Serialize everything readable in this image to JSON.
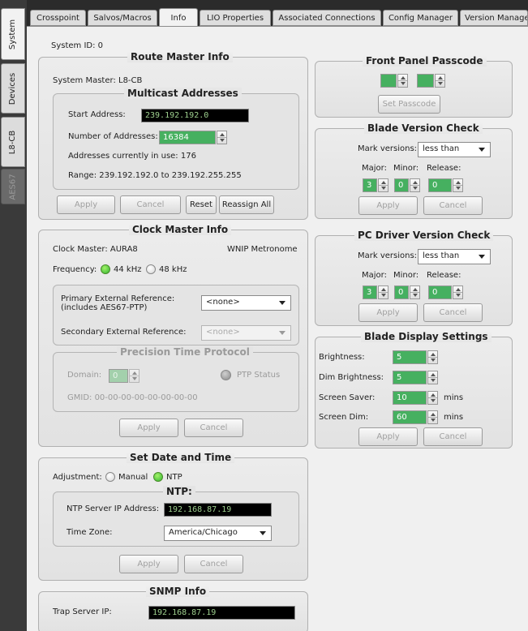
{
  "side_tabs": [
    "System",
    "Devices",
    "L8-CB",
    "AES67"
  ],
  "top_tabs": [
    "Crosspoint",
    "Salvos/Macros",
    "Info",
    "LIO Properties",
    "Associated Connections",
    "Config Manager",
    "Version Manage"
  ],
  "system_id": "System ID:  0",
  "route_master": {
    "title": "Route Master Info",
    "system_master": "System Master:  L8-CB",
    "multicast": {
      "title": "Multicast Addresses",
      "start_label": "Start Address:",
      "start_value": "239.192.192.0",
      "number_label": "Number of Addresses:",
      "number_value": "16384",
      "in_use": "Addresses currently in use:  176",
      "range": "Range:  239.192.192.0  to  239.192.255.255"
    },
    "buttons": {
      "apply": "Apply",
      "cancel": "Cancel",
      "reset": "Reset",
      "reassign": "Reassign All"
    }
  },
  "clock_master": {
    "title": "Clock Master Info",
    "clock_master": "Clock Master:  AURA8",
    "metronome": "WNIP Metronome",
    "frequency_label": "Frequency:",
    "freq_44": "44 kHz",
    "freq_48": "48 kHz",
    "primary_label": "Primary External Reference:",
    "primary_sub": "(includes AES67-PTP)",
    "primary_value": "<none>",
    "secondary_label": "Secondary External Reference:",
    "secondary_value": "<none>",
    "ptp": {
      "title": "Precision Time Protocol",
      "domain_label": "Domain:",
      "domain_value": "0",
      "status": "PTP Status",
      "gmid": "GMID:    00-00-00-00-00-00-00-00"
    },
    "buttons": {
      "apply": "Apply",
      "cancel": "Cancel"
    }
  },
  "date_time": {
    "title": "Set Date and Time",
    "adjustment_label": "Adjustment:",
    "manual": "Manual",
    "ntp": "NTP",
    "ntp_title": "NTP:",
    "server_label": "NTP Server IP Address:",
    "server_value": "192.168.87.19",
    "tz_label": "Time Zone:",
    "tz_value": "America/Chicago",
    "buttons": {
      "apply": "Apply",
      "cancel": "Cancel"
    }
  },
  "snmp": {
    "title": "SNMP Info",
    "trap_label": "Trap Server IP:",
    "trap_value": "192.168.87.19"
  },
  "front_panel": {
    "title": "Front Panel Passcode",
    "button": "Set Passcode"
  },
  "blade_version": {
    "title": "Blade Version Check",
    "mark_label": "Mark versions:",
    "mark_value": "less than",
    "major": "Major:",
    "minor": "Minor:",
    "release": "Release:",
    "major_v": "3",
    "minor_v": "0",
    "release_v": "0",
    "buttons": {
      "apply": "Apply",
      "cancel": "Cancel"
    }
  },
  "pc_driver": {
    "title": "PC Driver Version Check",
    "mark_label": "Mark versions:",
    "mark_value": "less than",
    "major": "Major:",
    "minor": "Minor:",
    "release": "Release:",
    "major_v": "3",
    "minor_v": "0",
    "release_v": "0",
    "buttons": {
      "apply": "Apply",
      "cancel": "Cancel"
    }
  },
  "blade_display": {
    "title": "Blade Display Settings",
    "brightness_label": "Brightness:",
    "brightness": "5",
    "dim_label": "Dim Brightness:",
    "dim": "5",
    "saver_label": "Screen Saver:",
    "saver": "10",
    "screendim_label": "Screen Dim:",
    "screendim": "60",
    "mins": "mins",
    "buttons": {
      "apply": "Apply",
      "cancel": "Cancel"
    }
  },
  "colors": {
    "accent_green": "#46b060",
    "field_black": "#000000",
    "field_text": "#9ed08e"
  }
}
